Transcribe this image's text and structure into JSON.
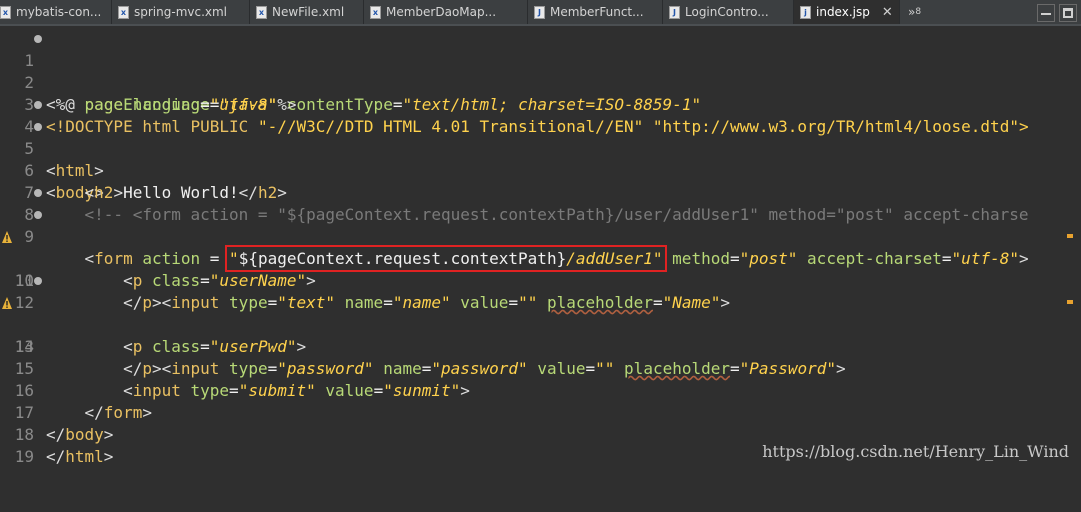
{
  "tabs": [
    {
      "label": "mybatis-con...",
      "icon": "xml-file-icon",
      "active": false
    },
    {
      "label": "spring-mvc.xml",
      "icon": "xml-file-icon",
      "active": false
    },
    {
      "label": "NewFile.xml",
      "icon": "xml-file-icon",
      "active": false
    },
    {
      "label": "MemberDaoMap...",
      "icon": "xml-file-icon",
      "active": false
    },
    {
      "label": "MemberFunct...",
      "icon": "java-file-icon",
      "active": false
    },
    {
      "label": "LoginContro...",
      "icon": "java-file-icon",
      "active": false
    },
    {
      "label": "index.jsp",
      "icon": "jsp-file-icon",
      "active": true
    }
  ],
  "tab_overflow": "»",
  "tab_overflow_count": "8",
  "lines": [
    {
      "n": "1",
      "fold": true,
      "warn": false
    },
    {
      "n": "2",
      "fold": false,
      "warn": false
    },
    {
      "n": "3",
      "fold": false,
      "warn": false
    },
    {
      "n": "4",
      "fold": true,
      "warn": false
    },
    {
      "n": "5",
      "fold": true,
      "warn": false
    },
    {
      "n": "6",
      "fold": false,
      "warn": false
    },
    {
      "n": "7",
      "fold": false,
      "warn": false
    },
    {
      "n": "8",
      "fold": true,
      "warn": false
    },
    {
      "n": "9",
      "fold": true,
      "warn": false
    },
    {
      "n": "10",
      "fold": false,
      "warn": true
    },
    {
      "n": "11",
      "fold": false,
      "warn": false
    },
    {
      "n": "12",
      "fold": true,
      "warn": false
    },
    {
      "n": "13",
      "fold": false,
      "warn": true
    },
    {
      "n": "14",
      "fold": false,
      "warn": false
    },
    {
      "n": "15",
      "fold": false,
      "warn": false
    },
    {
      "n": "16",
      "fold": false,
      "warn": false
    },
    {
      "n": "17",
      "fold": false,
      "warn": false
    },
    {
      "n": "18",
      "fold": false,
      "warn": false
    },
    {
      "n": "19",
      "fold": false,
      "warn": false
    }
  ],
  "code": {
    "l1": {
      "open": "<%@",
      "page": "page",
      "a1": "language",
      "v1": "\"java\"",
      "a2": "contentType",
      "v2": "\"text/html; charset=ISO-8859-1\""
    },
    "l2": {
      "a1": "pageEncoding",
      "v1": "\"utf-8\"",
      "close": "%>"
    },
    "l3": {
      "doctype": "<!DOCTYPE",
      "name": "html",
      "pub": "PUBLIC",
      "s1": "\"-//W3C//DTD HTML 4.01 Transitional//EN\"",
      "s2": "\"http://www.w3.org/TR/html4/loose.dtd\">"
    },
    "l4": {
      "tag": "html"
    },
    "l5": {
      "tag": "body"
    },
    "l6": {
      "tag": "h2",
      "text": "Hello World!"
    },
    "l7": {
      "comment": "<!-- <form action = \"${pageContext.request.contextPath}/user/addUser1\" method=\"post\" accept-charse"
    },
    "l8": {
      "tag": "form",
      "a1": "action",
      "eq": " =",
      "q": "\"",
      "el": "${pageContext.request.contextPath}",
      "path": "/addUser1\"",
      "a2": "method",
      "v2": "\"post\"",
      "a3": "accept-charset",
      "v3": "\"utf-8\""
    },
    "l9": {
      "tag": "p",
      "a1": "class",
      "v1": "\"userName\""
    },
    "l10": {
      "tag": "input",
      "a1": "type",
      "v1": "\"text\"",
      "a2": "name",
      "v2": "\"name\"",
      "a3": "value",
      "v3": "\"\"",
      "a4": "placeholder",
      "v4": "\"Name\""
    },
    "l11": {
      "tag": "p"
    },
    "l12": {
      "tag": "p",
      "a1": "class",
      "v1": "\"userPwd\""
    },
    "l13": {
      "tag": "input",
      "a1": "type",
      "v1": "\"password\"",
      "a2": "name",
      "v2": "\"password\"",
      "a3": "value",
      "v3": "\"\"",
      "a4": "placeholder",
      "v4": "\"Password\""
    },
    "l14": {
      "tag": "p"
    },
    "l15": {
      "tag": "input",
      "a1": "type",
      "v1": "\"submit\"",
      "a2": "value",
      "v2": "\"sunmit\""
    },
    "l16": {
      "tag": "form"
    },
    "l17": {
      "tag": "body"
    },
    "l18": {
      "tag": "html"
    }
  },
  "watermark": "https://blog.csdn.net/Henry_Lin_Wind",
  "colors": {
    "background": "#2f2f2f",
    "tag": "#e9c062",
    "attribute": "#b8d977",
    "string": "#ffd24d",
    "comment": "#7a7a7a",
    "highlight_box": "#e02222"
  }
}
